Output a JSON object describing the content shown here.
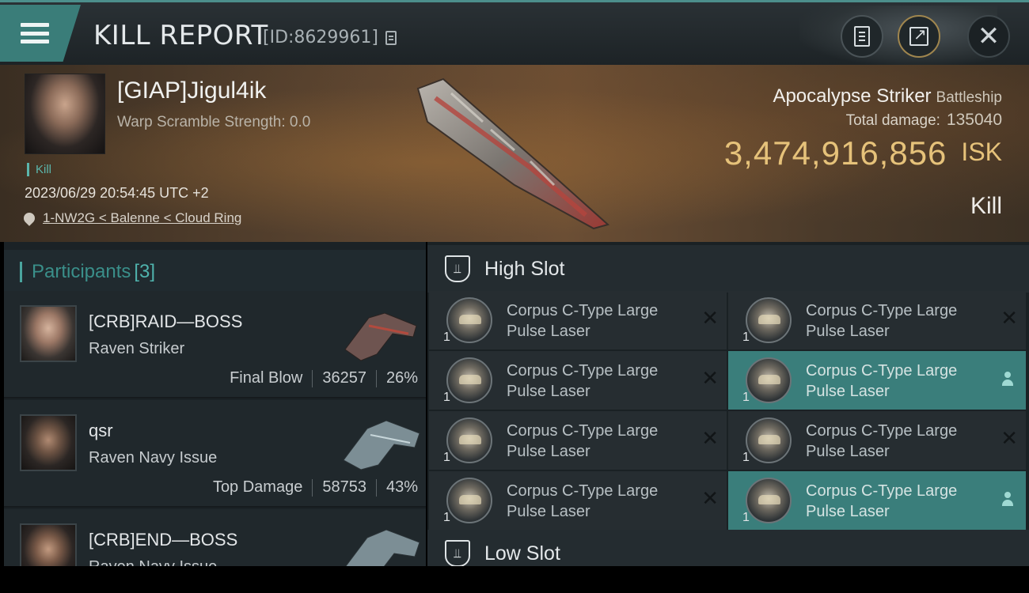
{
  "header": {
    "title": "KILL REPORT",
    "report_id": "[ID:8629961]"
  },
  "victim": {
    "name": "[GIAP]Jigul4ik",
    "warp_scramble": "Warp Scramble Strength: 0.0",
    "kill_tag": "Kill",
    "date": "2023/06/29 20:54:45 UTC +2",
    "location": "1-NW2G < Balenne < Cloud Ring",
    "ship_name": "Apocalypse Striker",
    "ship_class": "Battleship",
    "total_damage_label": "Total damage:",
    "total_damage": "135040",
    "isk_value": "3,474,916,856",
    "isk_unit": "ISK",
    "result": "Kill"
  },
  "participants": {
    "label": "Participants",
    "count": "[3]",
    "items": [
      {
        "name": "[CRB]RAID—BOSS",
        "ship": "Raven Striker",
        "role": "Final Blow",
        "damage": "36257",
        "percent": "26%"
      },
      {
        "name": "qsr",
        "ship": "Raven Navy Issue",
        "role": "Top Damage",
        "damage": "58753",
        "percent": "43%"
      },
      {
        "name": "[CRB]END—BOSS",
        "ship": "Raven Navy Issue",
        "role": "",
        "damage": "",
        "percent": ""
      }
    ]
  },
  "slots": {
    "high_title": "High Slot",
    "low_title": "Low Slot",
    "modules": [
      {
        "name": "Corpus C-Type Large Pulse Laser",
        "qty": "1",
        "state": "destroyed"
      },
      {
        "name": "Corpus C-Type Large Pulse Laser",
        "qty": "1",
        "state": "destroyed"
      },
      {
        "name": "Corpus C-Type Large Pulse Laser",
        "qty": "1",
        "state": "destroyed"
      },
      {
        "name": "Corpus C-Type Large Pulse Laser",
        "qty": "1",
        "state": "dropped"
      },
      {
        "name": "Corpus C-Type Large Pulse Laser",
        "qty": "1",
        "state": "destroyed"
      },
      {
        "name": "Corpus C-Type Large Pulse Laser",
        "qty": "1",
        "state": "destroyed"
      },
      {
        "name": "Corpus C-Type Large Pulse Laser",
        "qty": "1",
        "state": "destroyed"
      },
      {
        "name": "Corpus C-Type Large Pulse Laser",
        "qty": "1",
        "state": "dropped"
      }
    ]
  },
  "colors": {
    "accent_teal": "#3a7e7b",
    "isk_gold": "#e6c27a",
    "kill_green": "#5bb6ac"
  },
  "icons": [
    "menu-icon",
    "copy-icon",
    "document-icon",
    "share-icon",
    "close-icon",
    "location-pin-icon",
    "slot-icon",
    "destroyed-x-icon",
    "dropped-user-icon"
  ]
}
